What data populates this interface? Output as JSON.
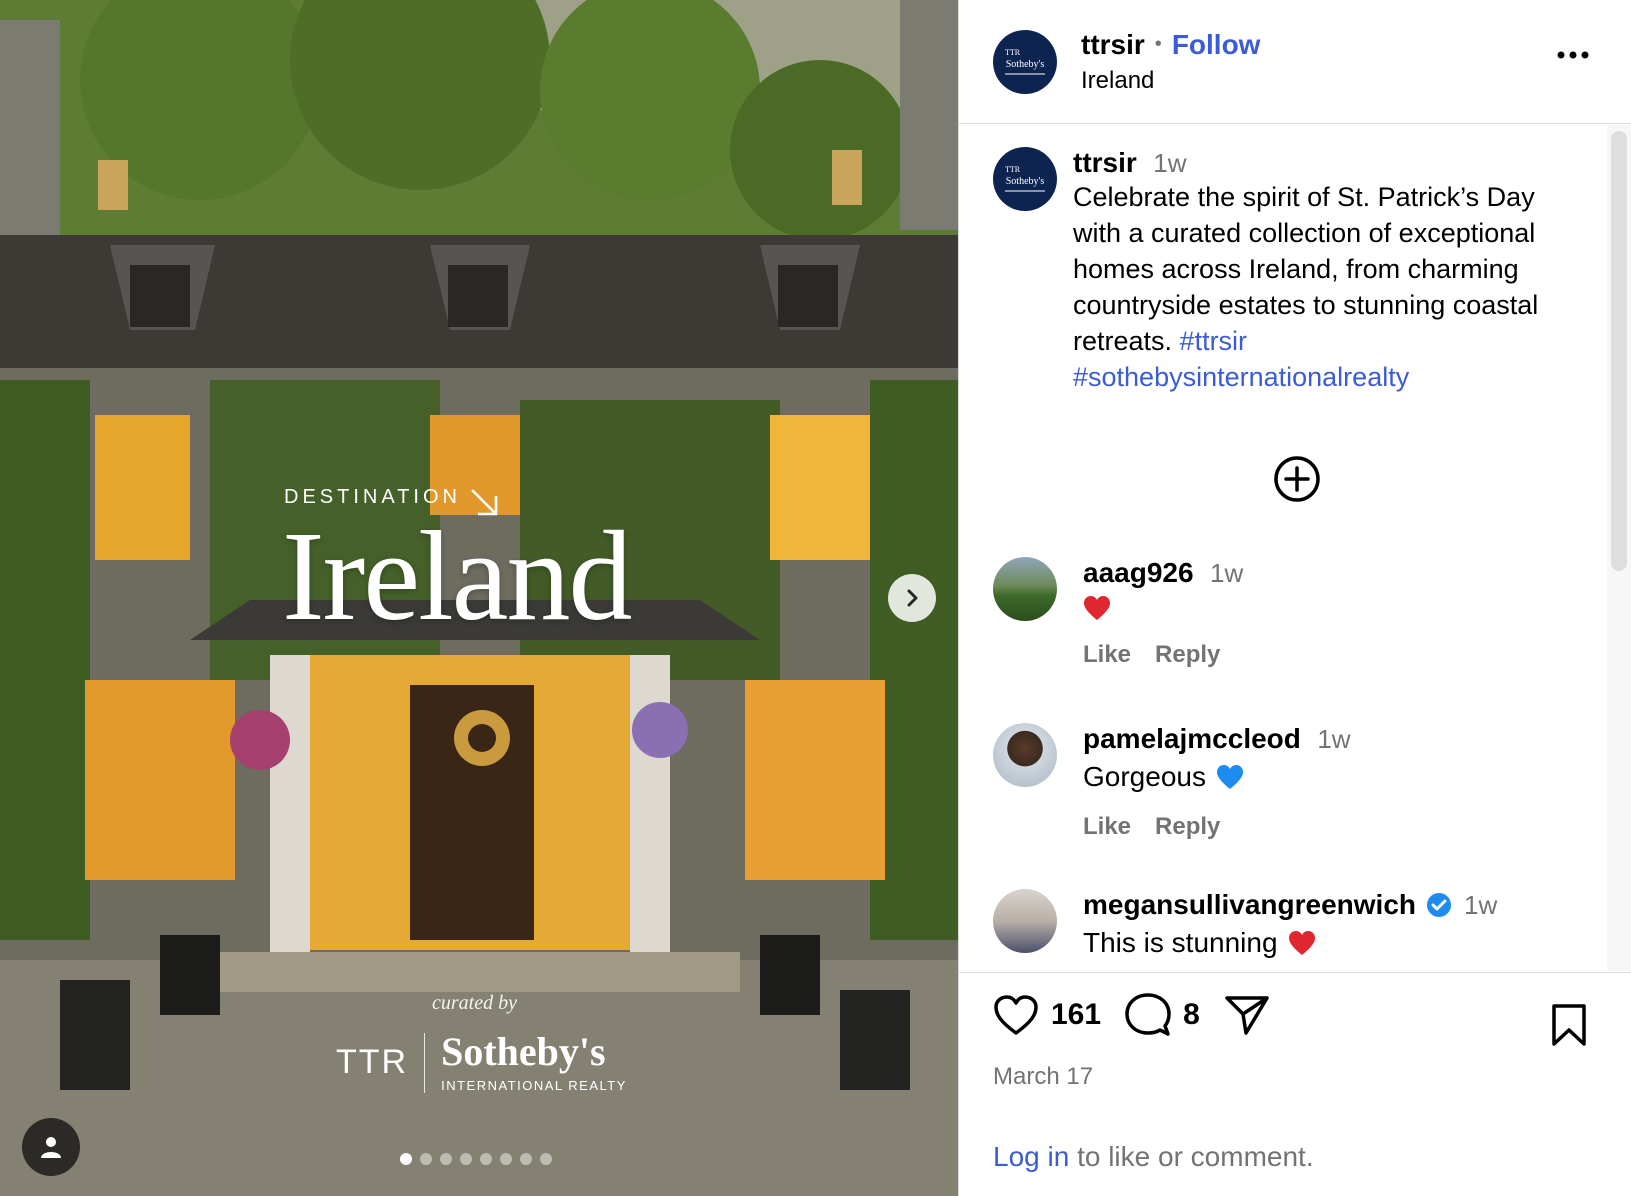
{
  "post_image": {
    "overlay_destination": "DESTINATION",
    "overlay_title": "Ireland",
    "overlay_curated": "curated by",
    "overlay_brand_ttr": "TTR",
    "overlay_brand_name": "Sotheby's",
    "overlay_brand_sub": "INTERNATIONAL REALTY",
    "carousel_total": 8,
    "carousel_index": 1
  },
  "header": {
    "username": "ttrsir",
    "separator": "•",
    "follow_label": "Follow",
    "location": "Ireland",
    "avatar_text_top": "TTR",
    "avatar_text_main": "Sotheby's"
  },
  "caption": {
    "username": "ttrsir",
    "time": "1w",
    "text": "Celebrate the spirit of St. Patrick’s Day with a curated collection of exceptional homes across Ireland, from charming countryside estates to stunning coastal retreats. ",
    "hashtag1": "#ttrsir",
    "hashtag2": "#sothebysinternationalrealty"
  },
  "comments": [
    {
      "username": "aaag926",
      "time": "1w",
      "text": "",
      "emoji": "red-heart",
      "like_label": "Like",
      "reply_label": "Reply"
    },
    {
      "username": "pamelajmccleod",
      "time": "1w",
      "text": "Gorgeous",
      "emoji": "blue-heart",
      "like_label": "Like",
      "reply_label": "Reply"
    },
    {
      "username": "megansullivangreenwich",
      "time": "1w",
      "text": "This is stunning",
      "emoji": "red-heart",
      "verified": true
    }
  ],
  "footer": {
    "likes": "161",
    "comments": "8",
    "date": "March 17",
    "login_link": "Log in",
    "login_rest": " to like or comment."
  },
  "colors": {
    "link_blue": "#3c5bd6",
    "secondary_text": "#737373",
    "brand_navy": "#0d2451",
    "heart_red": "#e0272f",
    "heart_blue": "#1d8cf0",
    "verified_blue": "#1d8cf0"
  }
}
